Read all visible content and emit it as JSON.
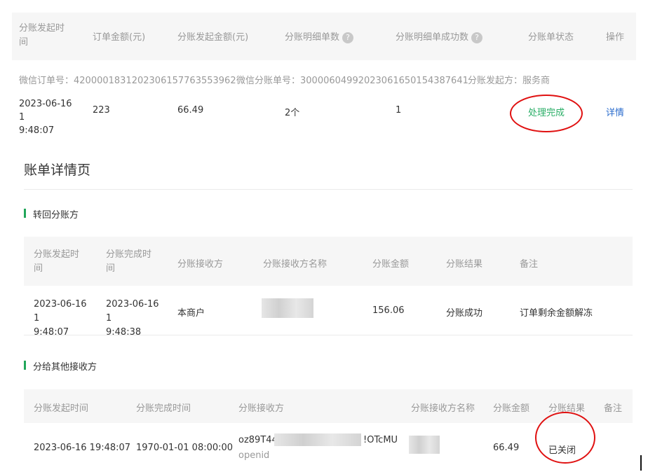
{
  "top_table": {
    "headers": {
      "initiate_time": "分账发起时\n间",
      "order_amount": "订单金额(元)",
      "initiate_amount": "分账发起金额(元)",
      "detail_count": "分账明细单数",
      "detail_success_count": "分账明细单成功数",
      "status": "分账单状态",
      "action": "操作"
    },
    "help_glyph": "?",
    "info": {
      "wechat_order": "微信订单号：4200001831202306157763553962",
      "wechat_split": "微信分账单号：3000060499202306165015438764­1",
      "initiator": "分账发起方：服务商"
    },
    "row": {
      "time": "2023-06-16 1\n9:48:07",
      "order_amount": "223",
      "initiate_amount": "66.49",
      "detail_count": "2个",
      "success_count": "1",
      "status": "处理完成",
      "action": "详情"
    }
  },
  "page_title": "账单详情页",
  "section_return": {
    "title": "转回分账方",
    "headers": {
      "initiate_time": "分账发起时\n间",
      "complete_time": "分账完成时\n间",
      "receiver": "分账接收方",
      "receiver_name": "分账接收方名称",
      "amount": "分账金额",
      "result": "分账结果",
      "remark": "备注"
    },
    "row": {
      "initiate_time": "2023-06-16 1\n9:48:07",
      "complete_time": "2023-06-16 1\n9:48:38",
      "receiver": "本商户",
      "amount": "156.06",
      "result": "分账成功",
      "remark": "订单剩余金额解冻"
    }
  },
  "section_others": {
    "title": "分给其他接收方",
    "headers": {
      "initiate_time": "分账发起时间",
      "complete_time": "分账完成时间",
      "receiver": "分账接收方",
      "receiver_name": "分账接收方名称",
      "amount": "分账金额",
      "result": "分账结果",
      "remark": "备注"
    },
    "row": {
      "initiate_time": "2023-06-16 19:48:07",
      "complete_time": "1970-01-01 08:00:00",
      "receiver_prefix": "oz89T44",
      "receiver_suffix": "!OTcMU",
      "receiver_type": "openid",
      "amount": "66.49",
      "result": "已关闭"
    }
  },
  "colors": {
    "status_green": "#2aae67",
    "link_blue": "#2b6ccd",
    "annotation_red": "#e01010",
    "section_bar_green": "#21a65a",
    "header_bg": "#f6f6f6"
  }
}
